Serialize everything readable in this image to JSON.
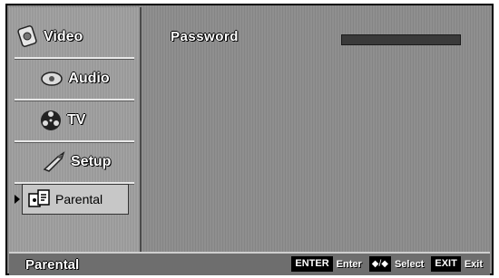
{
  "sidebar": {
    "items": [
      {
        "label": "Video",
        "icon": "video-icon",
        "selected": false
      },
      {
        "label": "Audio",
        "icon": "audio-icon",
        "selected": false
      },
      {
        "label": "TV",
        "icon": "tv-reel-icon",
        "selected": false
      },
      {
        "label": "Setup",
        "icon": "setup-icon",
        "selected": false
      },
      {
        "label": "Parental",
        "icon": "parental-icon",
        "selected": true
      }
    ]
  },
  "main": {
    "password_label": "Password"
  },
  "footer": {
    "title": "Parental",
    "hints": [
      {
        "key": "ENTER",
        "text": "Enter"
      },
      {
        "key": "◆/◆",
        "text": "Select"
      },
      {
        "key": "EXIT",
        "text": "Exit"
      }
    ]
  }
}
